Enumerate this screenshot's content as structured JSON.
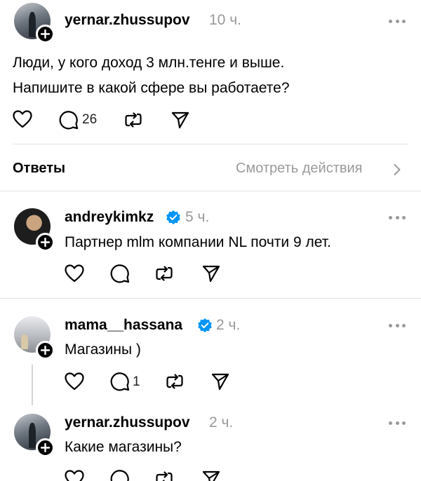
{
  "original_post": {
    "username": "yernar.zhussupov",
    "time": "10 ч.",
    "text_lines": [
      "Люди, у кого доход 3 млн.тенге и выше.",
      "Напишите в какой сфере вы работаете?"
    ],
    "reply_count": "26"
  },
  "replies_header": {
    "title": "Ответы",
    "activity_link": "Смотреть действия"
  },
  "replies": [
    {
      "username": "andreykimkz",
      "verified": true,
      "time": "5 ч.",
      "text": "Партнер mlm компании NL почти 9 лет.",
      "reply_count": ""
    },
    {
      "username": "mama__hassana",
      "verified": true,
      "time": "2 ч.",
      "text": "Магазины )",
      "reply_count": "1"
    },
    {
      "username": "yernar.zhussupov",
      "verified": false,
      "time": "2 ч.",
      "text": "Какие магазины?",
      "reply_count": ""
    }
  ],
  "colors": {
    "verified_blue": "#0095f6",
    "muted_text": "#999999",
    "divider": "#e4e4e4"
  },
  "icons": [
    "heart-icon",
    "comment-icon",
    "repost-icon",
    "share-icon",
    "more-icon",
    "verified-icon",
    "follow-plus-icon",
    "chevron-right-icon"
  ]
}
